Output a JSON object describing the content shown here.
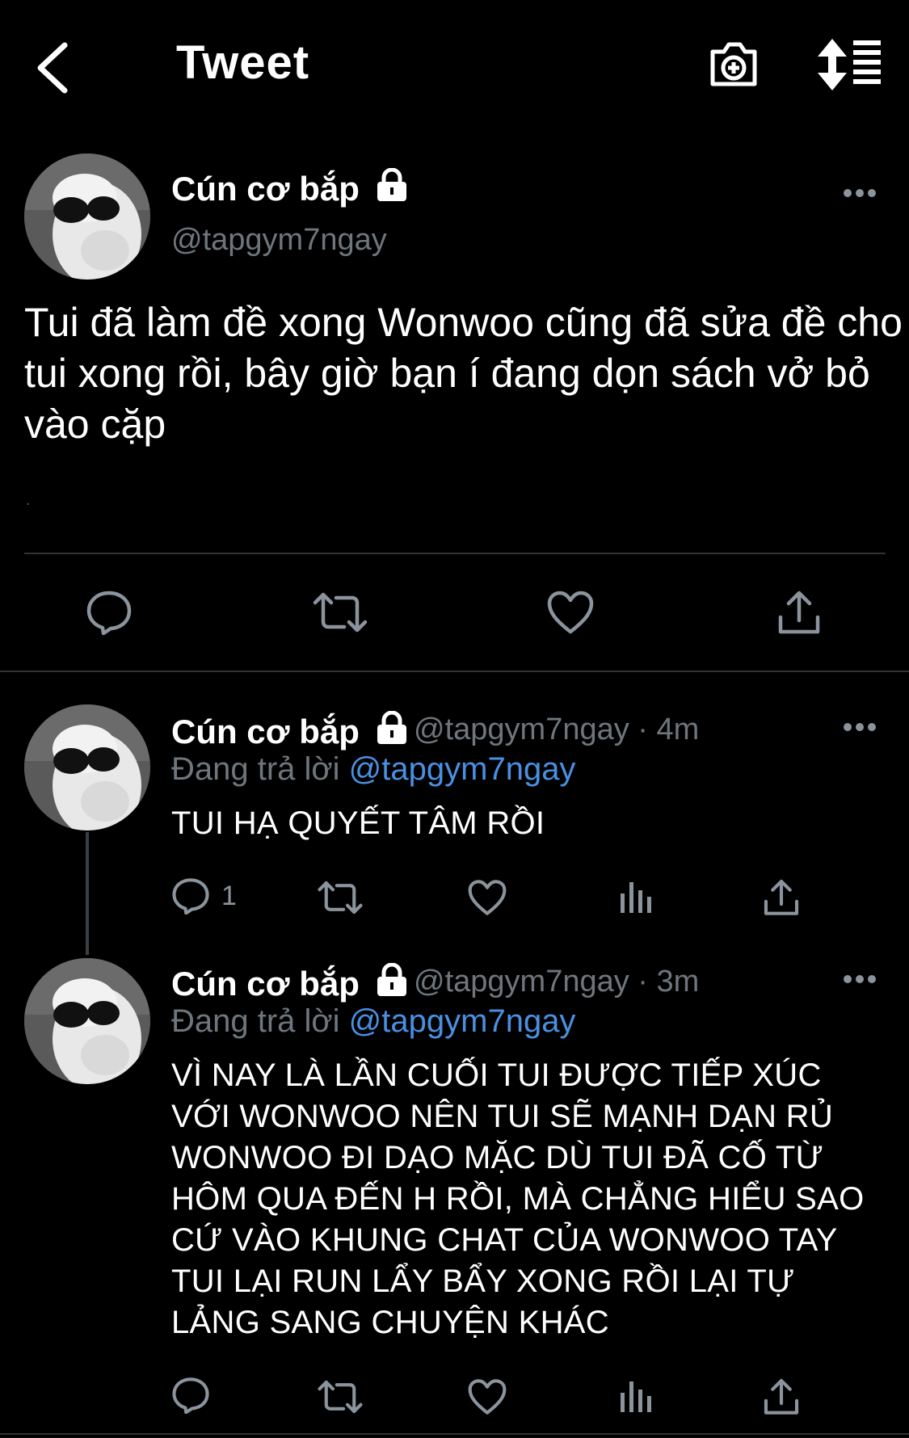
{
  "header": {
    "title": "Tweet",
    "back_icon": "chevron-left-icon",
    "camera_icon": "camera-add-icon",
    "sort_icon": "sort-icon"
  },
  "main_tweet": {
    "author_name": "Cún cơ bắp",
    "handle": "@tapgym7ngay",
    "text": "Tui đã làm đề xong Wonwoo cũng đã sửa đề cho tui xong rồi, bây giờ bạn í đang dọn sách vở bỏ vào cặp",
    "dot": "."
  },
  "replies": [
    {
      "author_name": "Cún cơ bắp",
      "handle": "@tapgym7ngay",
      "separator": "·",
      "time": "4m",
      "replying_to_label": "Đang trả lời",
      "replying_to": "@tapgym7ngay",
      "text": "TUI HẠ QUYẾT TÂM RỒI",
      "reply_count": "1"
    },
    {
      "author_name": "Cún cơ bắp",
      "handle": "@tapgym7ngay",
      "separator": "·",
      "time": "3m",
      "replying_to_label": "Đang trả lời",
      "replying_to": "@tapgym7ngay",
      "text": "VÌ NAY LÀ LẦN CUỐI TUI ĐƯỢC TIẾP XÚC VỚI WONWOO NÊN TUI SẼ MẠNH DẠN RỦ WONWOO ĐI DẠO MẶC DÙ TUI ĐÃ CỐ TỪ HÔM QUA ĐẾN H RỒI, MÀ CHẲNG HIỂU SAO CỨ VÀO KHUNG CHAT CỦA WONWOO TAY TUI LẠI RUN LẨY BẨY XONG RỒI LẠI TỰ LẢNG SANG CHUYỆN KHÁC"
    }
  ],
  "colors": {
    "background": "#000000",
    "text": "#ffffff",
    "secondary": "#6e767d",
    "icon": "#8b949c",
    "link": "#4a90e2",
    "divider": "#2f3336"
  }
}
